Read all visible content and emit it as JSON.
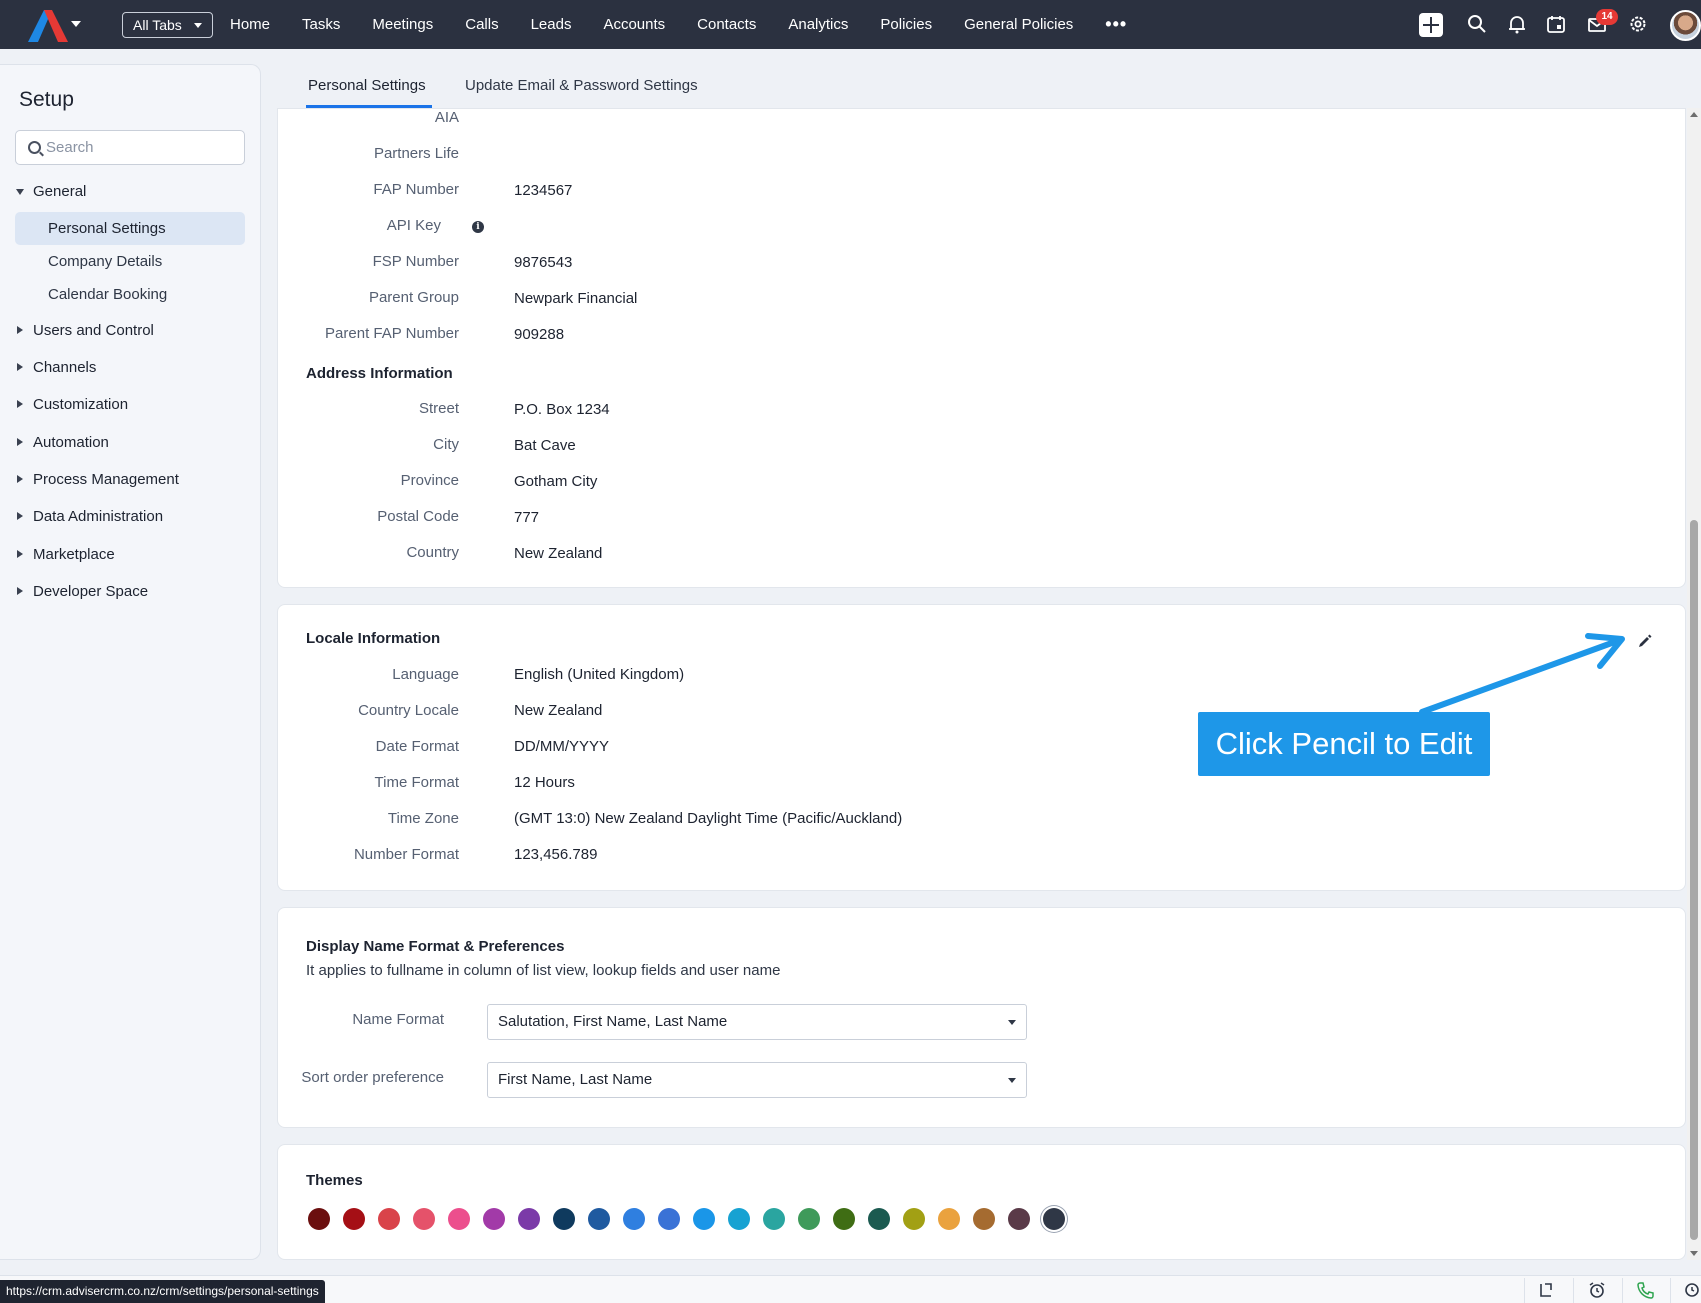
{
  "topbar": {
    "all_tabs": "All Tabs",
    "nav": [
      "Home",
      "Tasks",
      "Meetings",
      "Calls",
      "Leads",
      "Accounts",
      "Contacts",
      "Analytics",
      "Policies",
      "General Policies"
    ],
    "more": "•••",
    "notification_count": "14"
  },
  "sidebar": {
    "title": "Setup",
    "search_placeholder": "Search",
    "general": "General",
    "sub_items": [
      "Personal Settings",
      "Company Details",
      "Calendar Booking"
    ],
    "groups": [
      "Users and Control",
      "Channels",
      "Customization",
      "Automation",
      "Process Management",
      "Data Administration",
      "Marketplace",
      "Developer Space"
    ]
  },
  "tabs": {
    "personal": "Personal Settings",
    "update": "Update Email & Password Settings"
  },
  "profile_fields": [
    {
      "label": "AIA",
      "value": ""
    },
    {
      "label": "Partners Life",
      "value": ""
    },
    {
      "label": "FAP Number",
      "value": "1234567"
    },
    {
      "label": "API Key",
      "value": ""
    },
    {
      "label": "FSP Number",
      "value": "9876543"
    },
    {
      "label": "Parent Group",
      "value": "Newpark Financial"
    },
    {
      "label": "Parent FAP Number",
      "value": "909288"
    }
  ],
  "address": {
    "title": "Address Information",
    "fields": [
      {
        "label": "Street",
        "value": "P.O. Box 1234"
      },
      {
        "label": "City",
        "value": "Bat Cave"
      },
      {
        "label": "Province",
        "value": "Gotham City"
      },
      {
        "label": "Postal Code",
        "value": "777"
      },
      {
        "label": "Country",
        "value": "New Zealand"
      }
    ]
  },
  "locale": {
    "title": "Locale Information",
    "fields": [
      {
        "label": "Language",
        "value": "English (United Kingdom)"
      },
      {
        "label": "Country Locale",
        "value": "New Zealand"
      },
      {
        "label": "Date Format",
        "value": "DD/MM/YYYY"
      },
      {
        "label": "Time Format",
        "value": "12 Hours"
      },
      {
        "label": "Time Zone",
        "value": "(GMT 13:0) New Zealand Daylight Time (Pacific/Auckland)"
      },
      {
        "label": "Number Format",
        "value": "123,456.789"
      }
    ]
  },
  "callout": "Click Pencil to Edit",
  "display_name": {
    "title": "Display Name Format & Preferences",
    "description": "It applies to fullname in column of list view, lookup fields and user name",
    "name_format_label": "Name Format",
    "name_format_value": "Salutation, First Name, Last Name",
    "sort_label": "Sort order preference",
    "sort_value": "First Name, Last Name"
  },
  "themes": {
    "title": "Themes",
    "colors": [
      "#6b0f0f",
      "#a50f15",
      "#d9434a",
      "#e5526a",
      "#ec4f8d",
      "#a23aa8",
      "#7b3aa8",
      "#0f3a5e",
      "#1f5aa0",
      "#2f7fe0",
      "#3a72d6",
      "#1a96e8",
      "#17a2d2",
      "#2aa5a0",
      "#3f9a5a",
      "#3f6d14",
      "#1b5a50",
      "#a2a014",
      "#eaa23e",
      "#a56b30",
      "#5a3a48",
      "#2f3746"
    ],
    "selected_index": 21
  },
  "status_url": "https://crm.advisercrm.co.nz/crm/settings/personal-settings",
  "colors": {
    "accent": "#1a73e8",
    "topbar": "#2b3140",
    "callout": "#1e97e8"
  }
}
